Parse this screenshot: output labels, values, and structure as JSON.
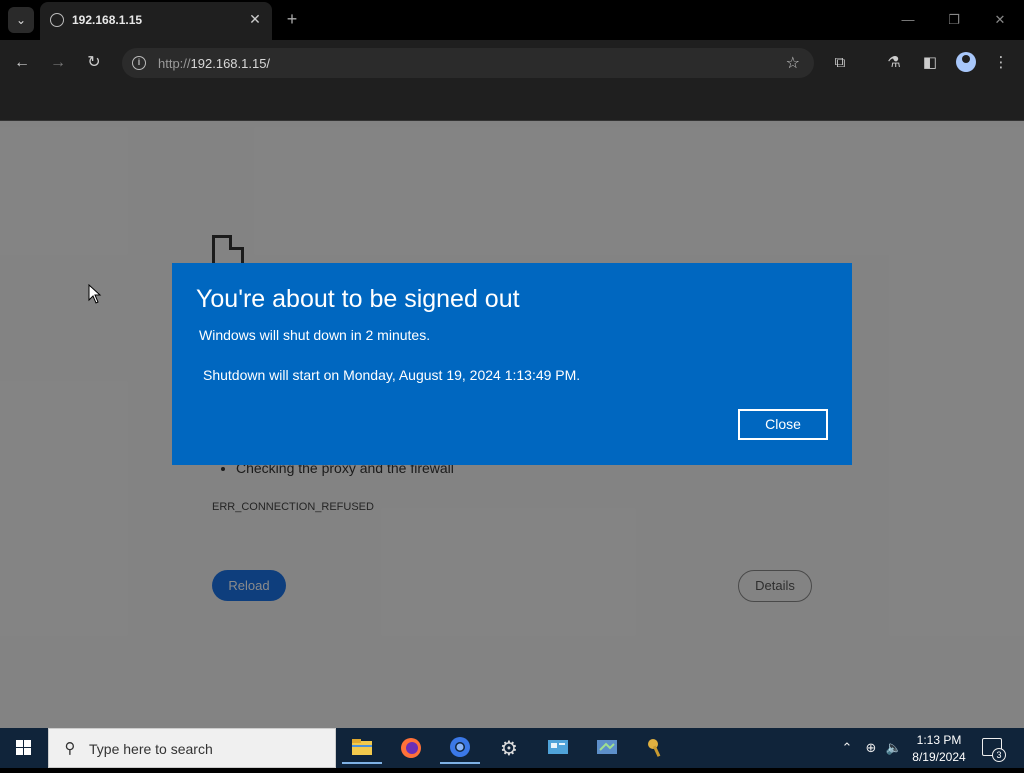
{
  "browser": {
    "tab_title": "192.168.1.15",
    "url_scheme": "http://",
    "url_host": "192.168.1.15/",
    "icons": {
      "tab_search": "chevron-down-icon",
      "favicon": "globe-icon",
      "tab_close": "close-icon",
      "new_tab": "plus-icon",
      "back": "back-arrow-icon",
      "forward": "forward-arrow-icon",
      "reload": "reload-icon",
      "site_info": "info-icon",
      "bookmark": "star-icon",
      "extensions": "puzzle-icon",
      "labs": "flask-icon",
      "side_panel": "side-panel-icon",
      "profile": "avatar-icon",
      "menu": "kebab-menu-icon"
    }
  },
  "page": {
    "bullet": "Checking the proxy and the firewall",
    "error_code": "ERR_CONNECTION_REFUSED",
    "reload_label": "Reload",
    "details_label": "Details"
  },
  "dialog": {
    "title": "You're about to be signed out",
    "line1": "Windows will shut down in 2 minutes.",
    "line2": "Shutdown will start on Monday, August 19, 2024 1:13:49 PM.",
    "close_label": "Close",
    "bg_color": "#0067c0"
  },
  "taskbar": {
    "search_placeholder": "Type here to search",
    "apps": [
      "file-explorer-icon",
      "firefox-icon",
      "chrome-icon",
      "settings-icon",
      "control-panel-icon",
      "screen-app-icon",
      "keys-app-icon"
    ],
    "time": "1:13 PM",
    "date": "8/19/2024",
    "notification_count": "3"
  }
}
